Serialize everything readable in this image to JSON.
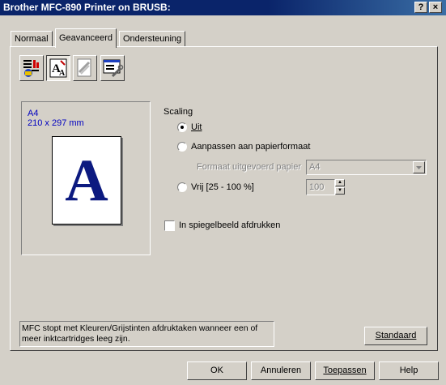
{
  "window": {
    "title": "Brother MFC-890 Printer on BRUSB:",
    "help_btn": "?",
    "close_btn": "×"
  },
  "tabs": [
    {
      "label": "Normaal",
      "active": false
    },
    {
      "label": "Geavanceerd",
      "active": true
    },
    {
      "label": "Ondersteuning",
      "active": false
    }
  ],
  "toolbar": {
    "icons": [
      "color-settings-icon",
      "scaling-icon",
      "watermark-icon",
      "device-options-icon"
    ],
    "selected": 1
  },
  "preview": {
    "paper_name": "A4",
    "paper_size": "210 x 297 mm",
    "letter": "A",
    "letter_color": "#0c1a80"
  },
  "scaling": {
    "group_label": "Scaling",
    "option_off": "Uit",
    "option_fit": "Aanpassen aan papierformaat",
    "output_format_label": "Formaat uitgevoerd papier",
    "output_format_value": "A4",
    "option_free": "Vrij [25 - 100 %]",
    "free_value": "100",
    "selected": "off"
  },
  "mirror": {
    "label": "In spiegelbeeld afdrukken",
    "checked": false
  },
  "status_message": "MFC stopt met Kleuren/Grijstinten afdruktaken wanneer een of meer inktcartridges leeg zijn.",
  "buttons": {
    "default": "Standaard",
    "ok": "OK",
    "cancel": "Annuleren",
    "apply": "Toepassen",
    "help": "Help"
  }
}
